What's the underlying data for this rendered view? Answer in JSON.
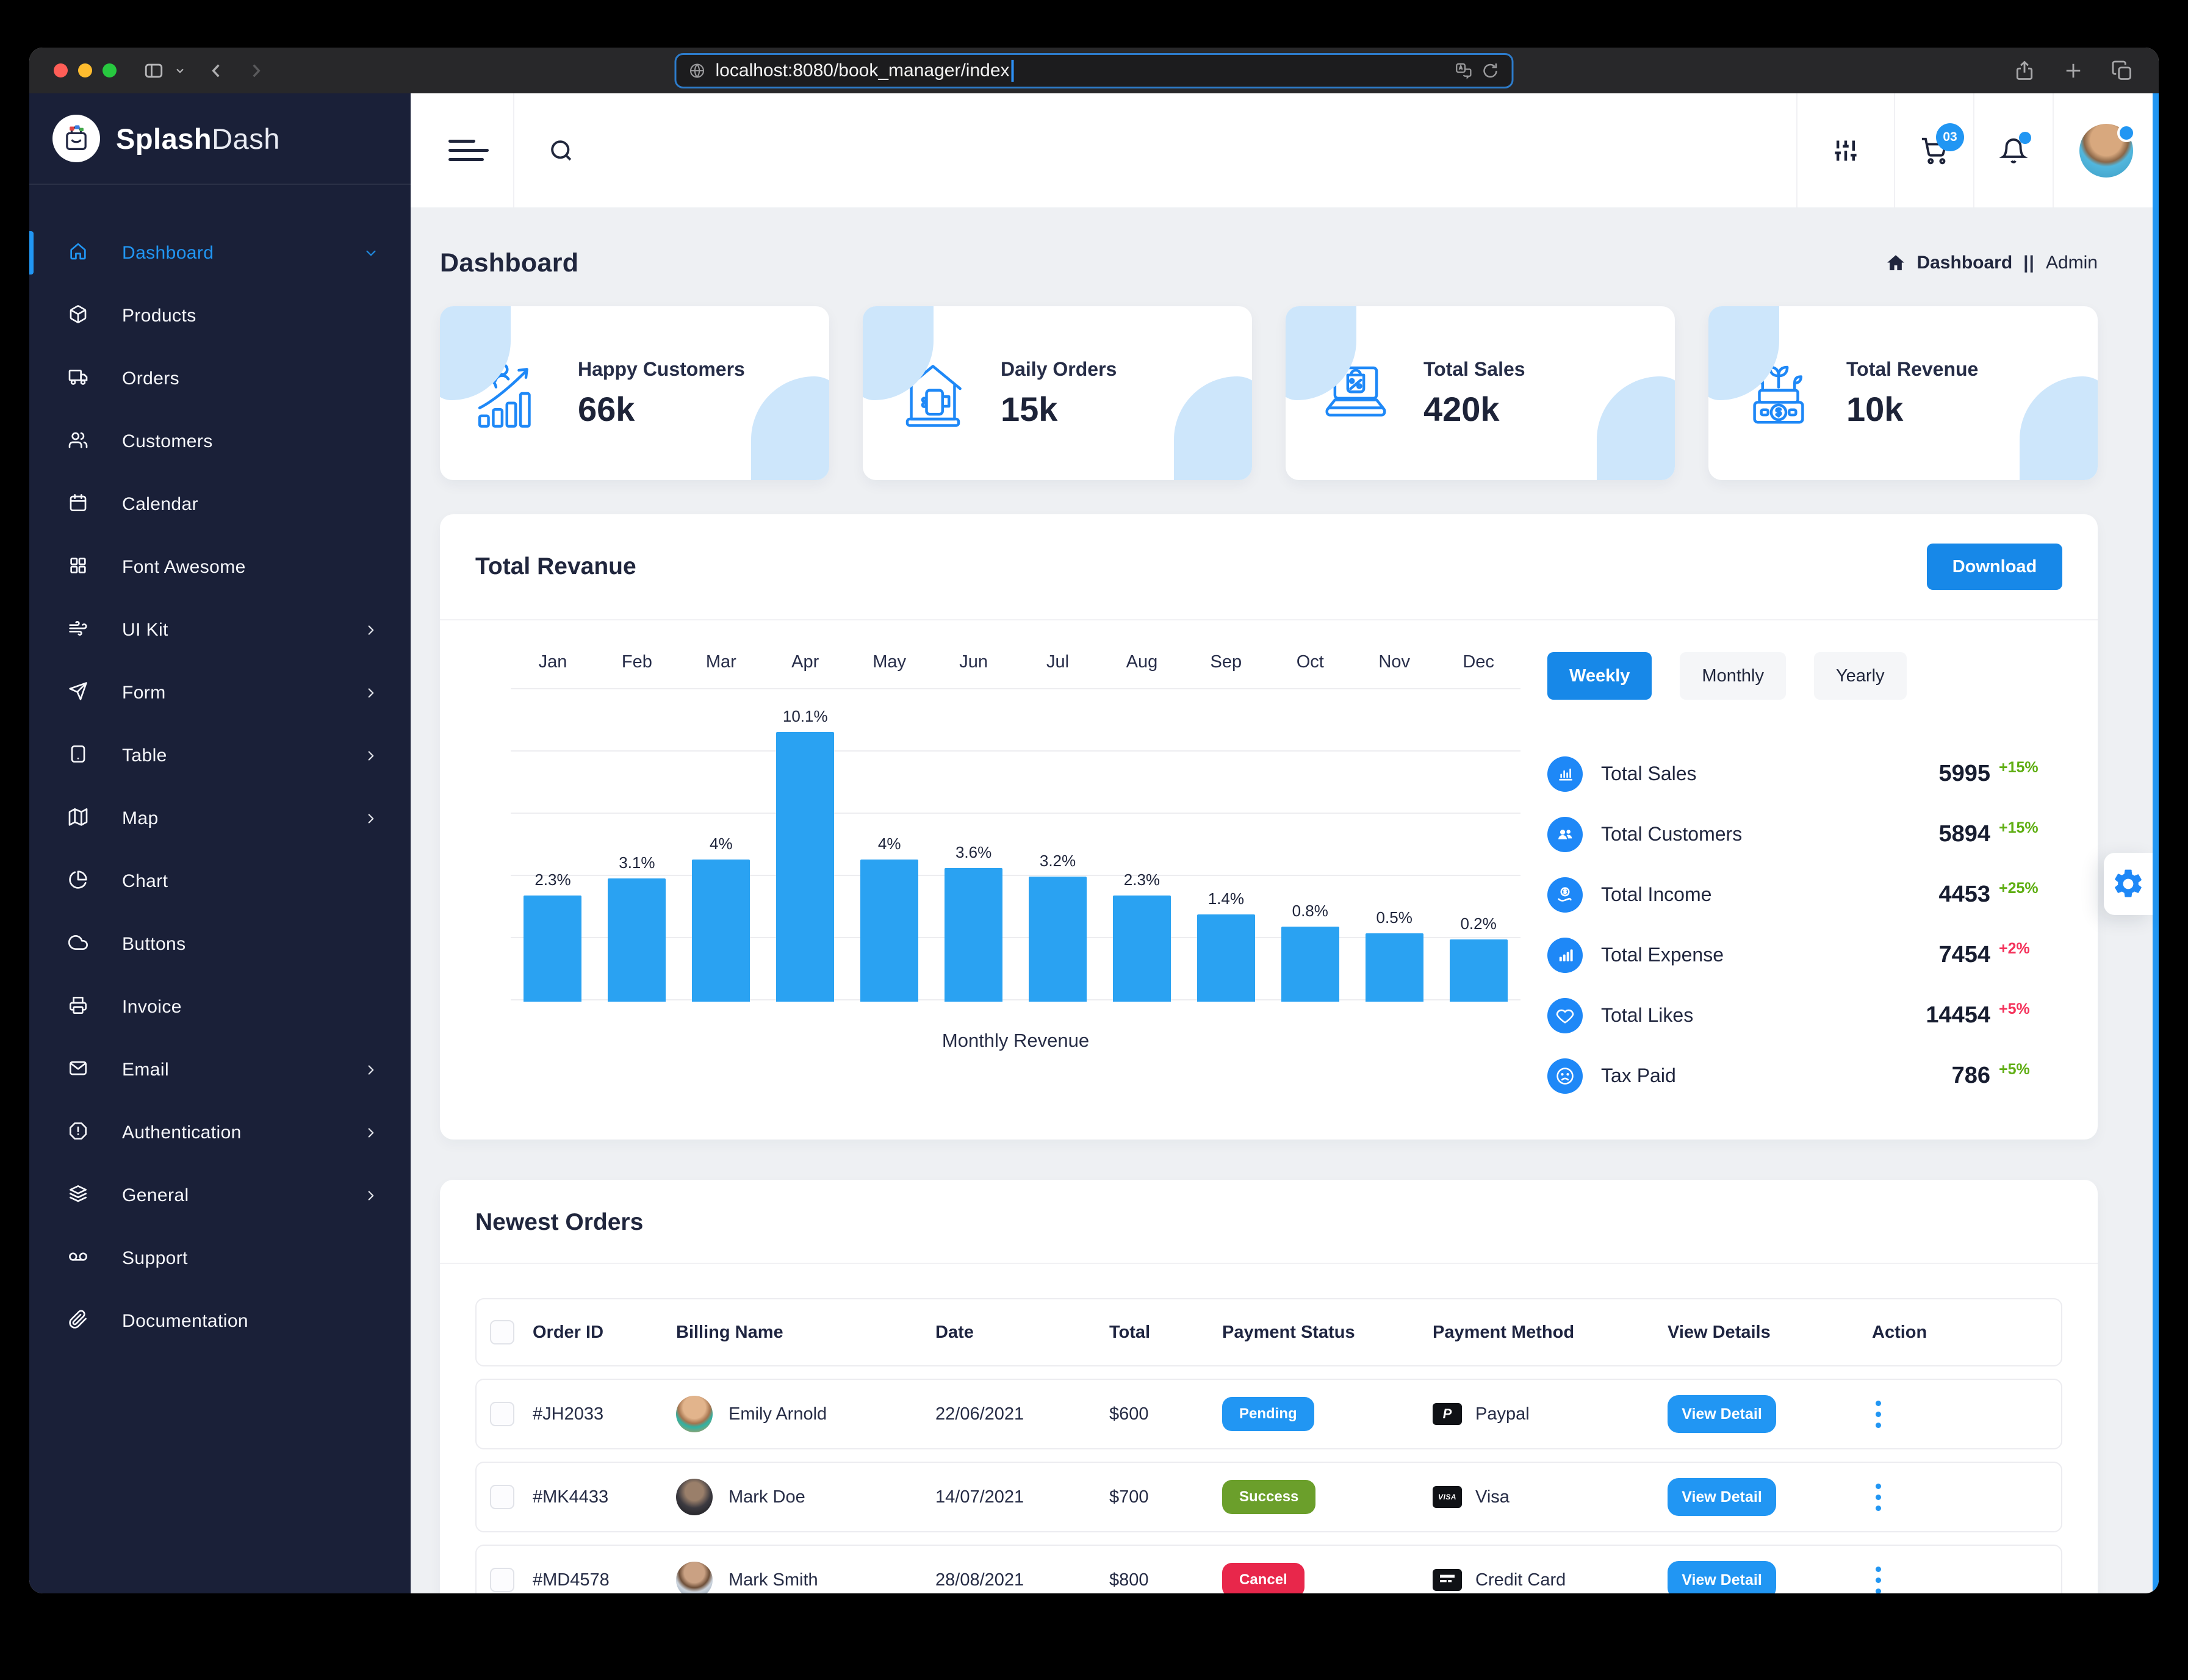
{
  "browser": {
    "url": "localhost:8080/book_manager/index"
  },
  "brand": {
    "bold": "Splash",
    "light": "Dash"
  },
  "sidebar": {
    "items": [
      {
        "label": "Dashboard",
        "icon": "home",
        "active": true,
        "chevron": "down"
      },
      {
        "label": "Products",
        "icon": "box"
      },
      {
        "label": "Orders",
        "icon": "truck"
      },
      {
        "label": "Customers",
        "icon": "users"
      },
      {
        "label": "Calendar",
        "icon": "calendar"
      },
      {
        "label": "Font Awesome",
        "icon": "grid"
      },
      {
        "label": "UI Kit",
        "icon": "wind",
        "chevron": "right"
      },
      {
        "label": "Form",
        "icon": "send",
        "chevron": "right"
      },
      {
        "label": "Table",
        "icon": "tablet",
        "chevron": "right"
      },
      {
        "label": "Map",
        "icon": "map",
        "chevron": "right"
      },
      {
        "label": "Chart",
        "icon": "pie-chart"
      },
      {
        "label": "Buttons",
        "icon": "cloud"
      },
      {
        "label": "Invoice",
        "icon": "printer"
      },
      {
        "label": "Email",
        "icon": "mail",
        "chevron": "right"
      },
      {
        "label": "Authentication",
        "icon": "alert-octagon",
        "chevron": "right"
      },
      {
        "label": "General",
        "icon": "layers",
        "chevron": "right"
      },
      {
        "label": "Support",
        "icon": "voicemail"
      },
      {
        "label": "Documentation",
        "icon": "paperclip"
      }
    ]
  },
  "header": {
    "cart_badge": "03"
  },
  "page": {
    "title": "Dashboard",
    "breadcrumb_section": "Dashboard",
    "breadcrumb_separator": "||",
    "breadcrumb_current": "Admin"
  },
  "stat_cards": [
    {
      "icon": "happy-customers",
      "label": "Happy Customers",
      "value": "66k"
    },
    {
      "icon": "daily-orders",
      "label": "Daily Orders",
      "value": "15k"
    },
    {
      "icon": "total-sales",
      "label": "Total Sales",
      "value": "420k"
    },
    {
      "icon": "total-revenue",
      "label": "Total Revenue",
      "value": "10k"
    }
  ],
  "revenue_section": {
    "title": "Total Revanue",
    "download_label": "Download",
    "tabs": [
      {
        "label": "Weekly",
        "active": true
      },
      {
        "label": "Monthly",
        "active": false
      },
      {
        "label": "Yearly",
        "active": false
      }
    ],
    "summary": [
      {
        "icon": "sum-sales",
        "label": "Total Sales",
        "value": "5995",
        "delta": "+15%",
        "trend": "up"
      },
      {
        "icon": "sum-customers",
        "label": "Total Customers",
        "value": "5894",
        "delta": "+15%",
        "trend": "up"
      },
      {
        "icon": "sum-income",
        "label": "Total Income",
        "value": "4453",
        "delta": "+25%",
        "trend": "up"
      },
      {
        "icon": "sum-expense",
        "label": "Total Expense",
        "value": "7454",
        "delta": "+2%",
        "trend": "down"
      },
      {
        "icon": "sum-likes",
        "label": "Total Likes",
        "value": "14454",
        "delta": "+5%",
        "trend": "down"
      },
      {
        "icon": "sum-tax",
        "label": "Tax Paid",
        "value": "786",
        "delta": "+5%",
        "trend": "up"
      }
    ]
  },
  "chart_data": {
    "type": "bar",
    "title": "Total Revanue",
    "categories": [
      "Jan",
      "Feb",
      "Mar",
      "Apr",
      "May",
      "Jun",
      "Jul",
      "Aug",
      "Sep",
      "Oct",
      "Nov",
      "Dec"
    ],
    "values": [
      2.3,
      3.1,
      4,
      10.1,
      4,
      3.6,
      3.2,
      2.3,
      1.4,
      0.8,
      0.5,
      0.2
    ],
    "labels": [
      "2.3%",
      "3.1%",
      "4%",
      "10.1%",
      "4%",
      "3.6%",
      "3.2%",
      "2.3%",
      "1.4%",
      "0.8%",
      "0.5%",
      "0.2%"
    ],
    "unit": "%",
    "xlabel": "Monthly Revenue",
    "ylabel": "",
    "ylim": [
      0,
      12
    ],
    "grid": true,
    "legend": "none",
    "bar_color": "#2aa2f2"
  },
  "orders": {
    "title": "Newest Orders",
    "columns": [
      "Order ID",
      "Billing Name",
      "Date",
      "Total",
      "Payment Status",
      "Payment Method",
      "View Details",
      "Action"
    ],
    "view_label": "View Detail",
    "rows": [
      {
        "order_id": "#JH2033",
        "billing_name": "Emily Arnold",
        "avatar": "emily",
        "date": "22/06/2021",
        "total": "$600",
        "status": "Pending",
        "status_key": "pending",
        "method": "Paypal",
        "method_icon": "paypal"
      },
      {
        "order_id": "#MK4433",
        "billing_name": "Mark Doe",
        "avatar": "mark-doe",
        "date": "14/07/2021",
        "total": "$700",
        "status": "Success",
        "status_key": "success",
        "method": "Visa",
        "method_icon": "visa"
      },
      {
        "order_id": "#MD4578",
        "billing_name": "Mark Smith",
        "avatar": "mark-smith",
        "date": "28/08/2021",
        "total": "$800",
        "status": "Cancel",
        "status_key": "cancel",
        "method": "Credit Card",
        "method_icon": "credit-card"
      }
    ]
  },
  "colors": {
    "accent": "#2196f3",
    "bar": "#2aa2f2",
    "pending": "#2196f3",
    "success": "#6b9f2b",
    "cancel": "#e8274b",
    "delta_up": "#5fae13",
    "delta_down": "#f4315a"
  }
}
